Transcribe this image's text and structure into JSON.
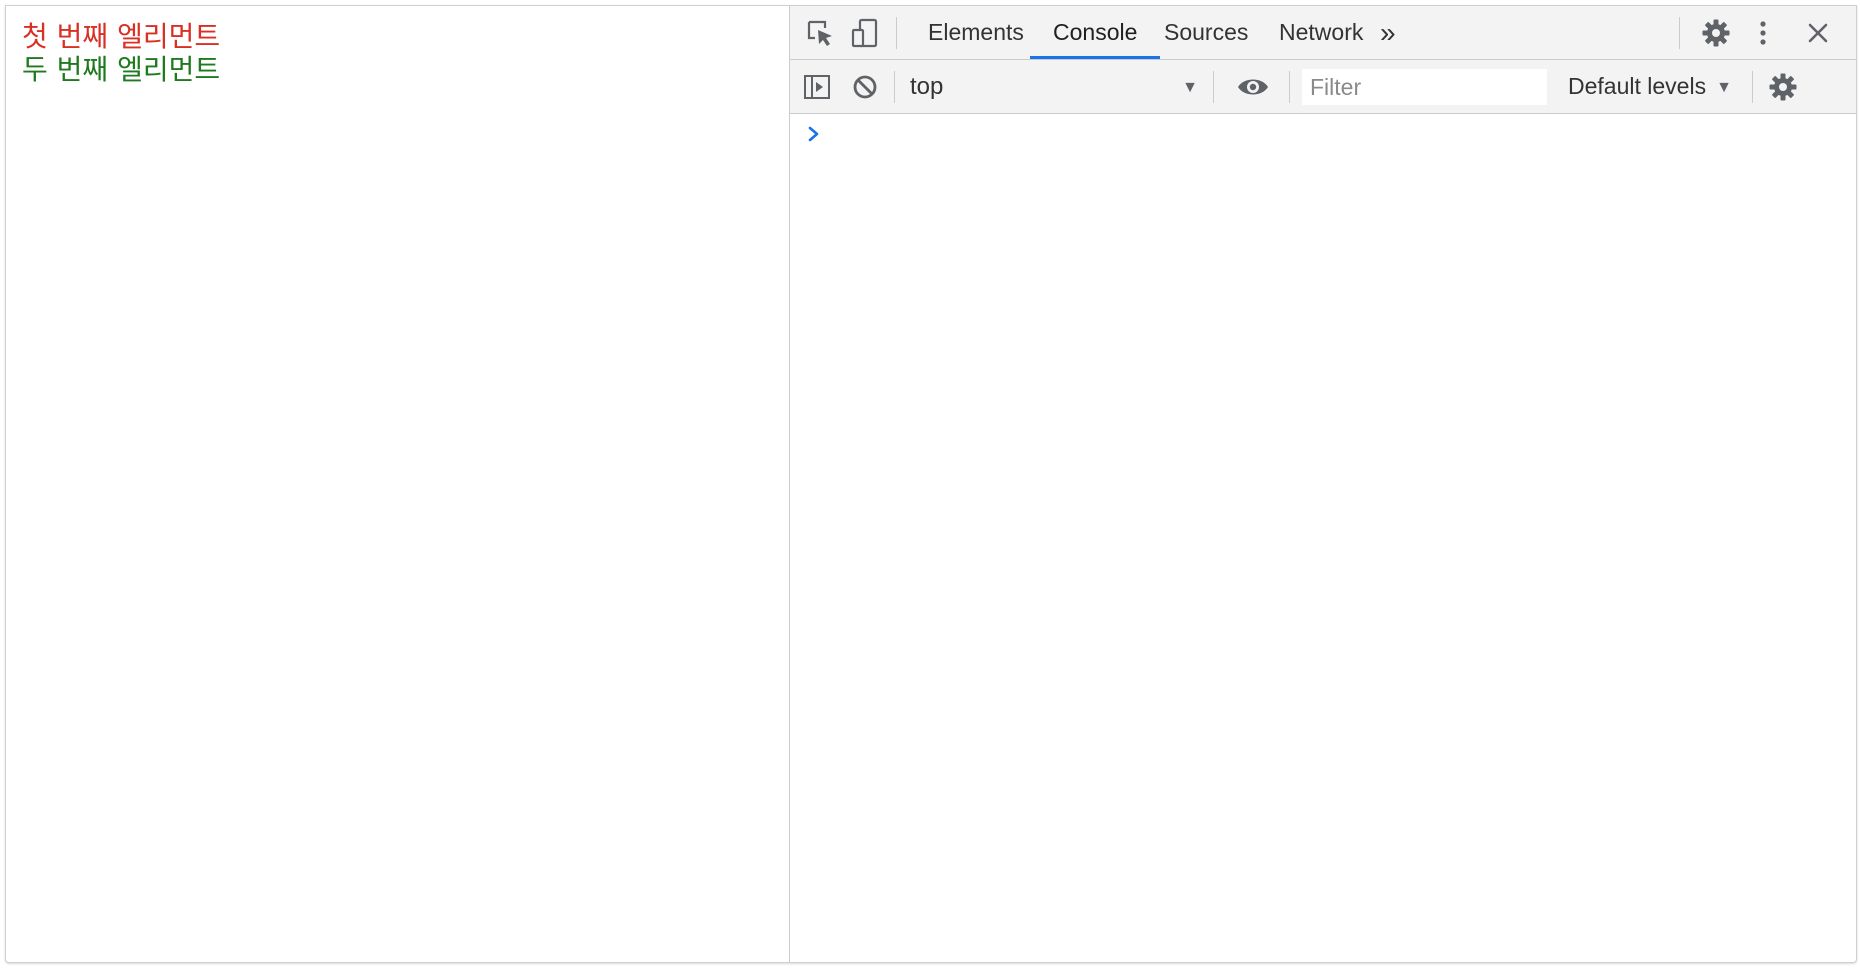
{
  "page": {
    "lines": [
      {
        "text": "첫 번째 엘리먼트",
        "color": "#d93025"
      },
      {
        "text": "두 번째 엘리먼트",
        "color": "#1e7a1e"
      }
    ]
  },
  "devtools": {
    "toolbar": {
      "inspect_icon": "select-element-icon",
      "device_icon": "device-toolbar-icon",
      "tabs": [
        {
          "label": "Elements",
          "active": false
        },
        {
          "label": "Console",
          "active": true
        },
        {
          "label": "Sources",
          "active": false
        },
        {
          "label": "Network",
          "active": false
        }
      ],
      "more_tabs_symbol": "»",
      "settings_icon": "gear-icon",
      "menu_icon": "vertical-dots-icon",
      "close_icon": "close-icon"
    },
    "console_toolbar": {
      "sidebar_icon": "show-sidebar-icon",
      "clear_icon": "clear-console-icon",
      "context": "top",
      "context_arrow": "▼",
      "live_expression_icon": "eye-icon",
      "filter_placeholder": "Filter",
      "filter_value": "",
      "levels_label": "Default levels",
      "levels_arrow": "▼",
      "settings_icon": "gear-icon"
    },
    "console": {
      "prompt_symbol": "›"
    }
  },
  "colors": {
    "accent": "#1a73e8",
    "toolbar_bg": "#f3f3f3",
    "border": "#cbcbcb"
  }
}
